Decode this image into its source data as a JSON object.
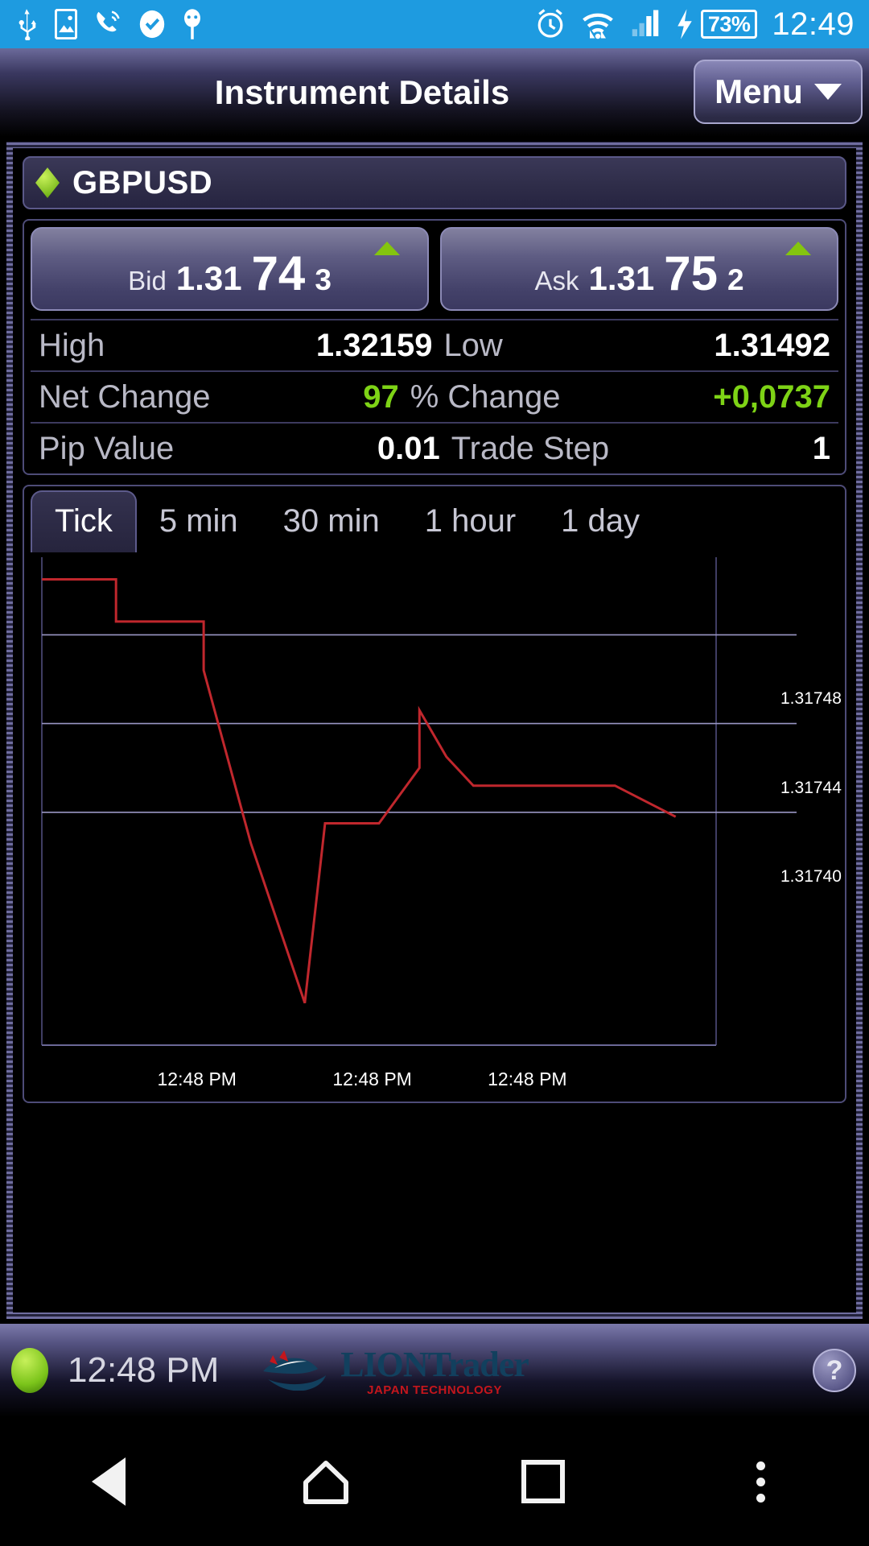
{
  "status_bar": {
    "icons": [
      "usb-icon",
      "image-icon",
      "call-icon",
      "check-circle-icon",
      "android-icon",
      "alarm-icon",
      "wifi-icon",
      "signal-icon",
      "charging-bolt-icon"
    ],
    "battery_percent": "73%",
    "clock": "12:49"
  },
  "title_bar": {
    "title": "Instrument Details",
    "menu_label": "Menu"
  },
  "instrument": {
    "symbol": "GBPUSD"
  },
  "quote": {
    "bid": {
      "label": "Bid",
      "lead": "1.31",
      "big": "74",
      "last": "3",
      "direction": "up"
    },
    "ask": {
      "label": "Ask",
      "lead": "1.31",
      "big": "75",
      "last": "2",
      "direction": "up"
    },
    "rows": [
      {
        "label1": "High",
        "value1": "1.32159",
        "label2": "Low",
        "value2": "1.31492",
        "value1_green": false,
        "value2_green": false
      },
      {
        "label1": "Net Change",
        "value1": "97",
        "label2": "% Change",
        "value2": "+0,0737",
        "value1_green": true,
        "value2_green": true
      },
      {
        "label1": "Pip Value",
        "value1": "0.01",
        "label2": "Trade Step",
        "value2": "1",
        "value1_green": false,
        "value2_green": false
      }
    ]
  },
  "chart": {
    "tabs": [
      {
        "label": "Tick",
        "active": true
      },
      {
        "label": "5 min",
        "active": false
      },
      {
        "label": "30 min",
        "active": false
      },
      {
        "label": "1 hour",
        "active": false
      },
      {
        "label": "1 day",
        "active": false
      }
    ]
  },
  "chart_data": {
    "type": "line",
    "title": "",
    "xlabel": "",
    "ylabel": "",
    "series": [
      {
        "name": "GBPUSD Tick",
        "color": "#c0272d",
        "x": [
          0,
          11,
          11,
          24,
          24,
          31,
          39,
          42,
          50,
          56,
          56,
          60,
          64,
          68,
          85,
          94
        ],
        "y": [
          1.317505,
          1.317505,
          1.317486,
          1.317486,
          1.317464,
          1.317386,
          1.317314,
          1.317395,
          1.317395,
          1.31742,
          1.317446,
          1.317425,
          1.317412,
          1.317412,
          1.317412,
          1.317398
        ]
      }
    ],
    "ytick_labels": [
      "1.31748",
      "1.31744",
      "1.31740"
    ],
    "ytick_values": [
      1.31748,
      1.31744,
      1.3174
    ],
    "xtick_labels": [
      "12:48 PM",
      "12:48 PM",
      "12:48 PM"
    ],
    "ylim": [
      1.317295,
      1.317515
    ],
    "grid": true,
    "legend": "none"
  },
  "footer": {
    "time": "12:48 PM",
    "logo_main_1": "LION",
    "logo_main_2": "Trader",
    "logo_sub": "JAPAN TECHNOLOGY",
    "help_label": "?"
  },
  "nav_bar": {
    "back": "back-icon",
    "home": "home-icon",
    "recents": "recents-icon",
    "overflow": "overflow-menu-icon"
  },
  "colors": {
    "status_bar_blue": "#1e9be0",
    "accent_green": "#7ed316",
    "chart_line": "#c0272d",
    "panel_purple": "#5d5b8c"
  }
}
